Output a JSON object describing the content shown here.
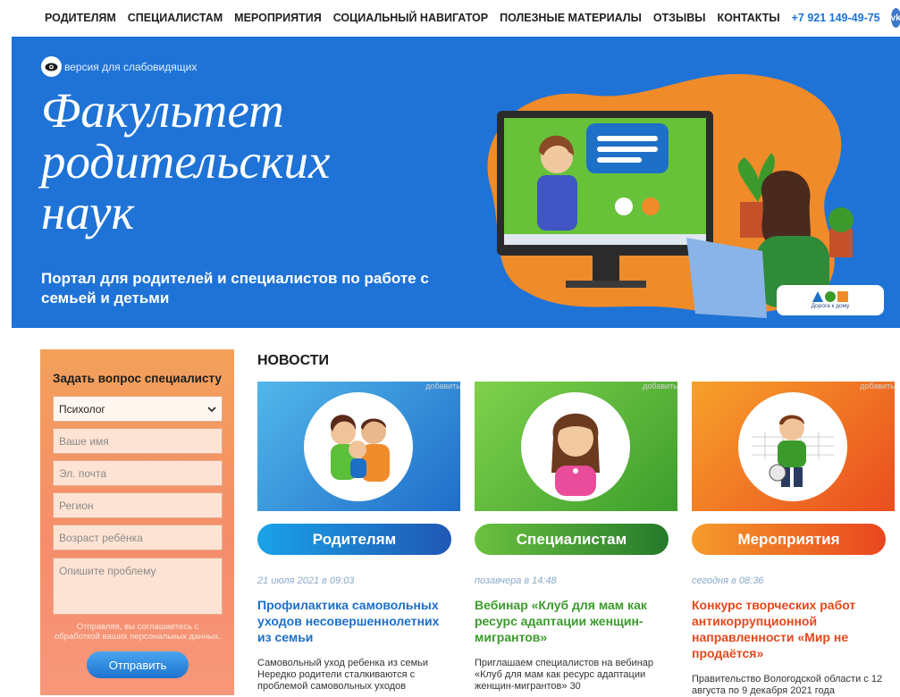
{
  "nav": {
    "items": [
      "РОДИТЕЛЯМ",
      "СПЕЦИАЛИСТАМ",
      "МЕРОПРИЯТИЯ",
      "СОЦИАЛЬНЫЙ НАВИГАТОР",
      "ПОЛЕЗНЫЕ МАТЕРИАЛЫ",
      "ОТЗЫВЫ",
      "КОНТАКТЫ"
    ],
    "phone": "+7 921 149-49-75",
    "vk": "vk"
  },
  "hero": {
    "low_vision": "версия для слабовидящих",
    "title": "Факультет\nродительских\nнаук",
    "subtitle": "Портал для родителей и специалистов по работе с семьей и детьми",
    "badge_label": "Дорога к дому"
  },
  "form": {
    "title": "Задать вопрос специалисту",
    "select_value": "Психолог",
    "name_placeholder": "Ваше имя",
    "email_placeholder": "Эл. почта",
    "region_placeholder": "Регион",
    "age_placeholder": "Возраст ребёнка",
    "problem_placeholder": "Опишите проблему",
    "consent": "Отправляя, вы соглашаетесь с обработкой ваших персональных данных.",
    "submit": "Отправить"
  },
  "news": {
    "heading": "НОВОСТИ",
    "add_label": "добавить",
    "cards": [
      {
        "category": "Родителям",
        "date": "21 июля 2021 в 09:03",
        "title": "Профилактика самовольных уходов несовершеннолетних из семьи",
        "text": "Самовольный уход ребенка из семьи Нередко родители сталкиваются с проблемой самовольных уходов",
        "title_color": "#1d6fc7"
      },
      {
        "category": "Специалистам",
        "date": "позавчера в 14:48",
        "title": "Вебинар «Клуб для мам как ресурс адаптации женщин-мигрантов»",
        "text": "Приглашаем специалистов на вебинар «Клуб для мам как ресурс адаптации женщин-мигрантов» 30",
        "title_color": "#3c9a2d"
      },
      {
        "category": "Мероприятия",
        "date": "сегодня в 08:36",
        "title": "Конкурс творческих работ антикоррупционной направленности «Мир не продаётся»",
        "text": "Правительство Вологодской области с 12 августа по 9 декабря 2021 года",
        "title_color": "#e4471c"
      }
    ]
  },
  "colors": {
    "hero_bg": "#1f73d6",
    "accent_blue": "#1b73d6",
    "parents": "#1d6fc7",
    "specialists": "#3c9a2d",
    "events": "#e4471c"
  }
}
